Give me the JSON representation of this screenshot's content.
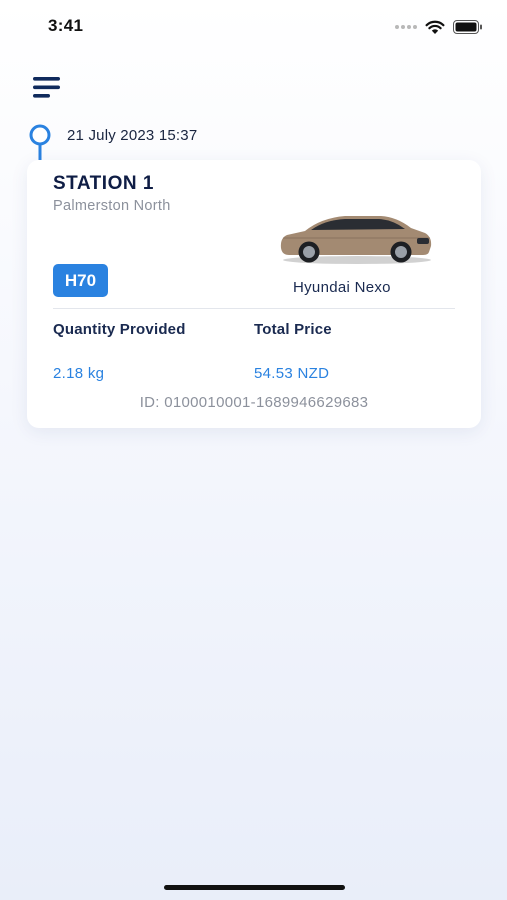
{
  "status_bar": {
    "time": "3:41",
    "icons": [
      "signal-icon",
      "wifi-icon",
      "battery-icon"
    ]
  },
  "header": {
    "menu_icon": "menu-icon"
  },
  "timeline": {
    "date": "21 July 2023 15:37",
    "marker_icon": "timeline-pin-icon"
  },
  "card": {
    "station_name": "STATION 1",
    "location": "Palmerston North",
    "pressure_badge": "H70",
    "car_model": "Hyundai Nexo",
    "car_image": "car-image",
    "stats": {
      "quantity_label": "Quantity Provided",
      "quantity_value": "2.18 kg",
      "price_label": "Total Price",
      "price_value": "54.53 NZD"
    },
    "id_text": "ID: 0100010001-1689946629683"
  },
  "colors": {
    "accent": "#2a82e0",
    "navy": "#0f1d45",
    "muted": "#8c919c"
  }
}
